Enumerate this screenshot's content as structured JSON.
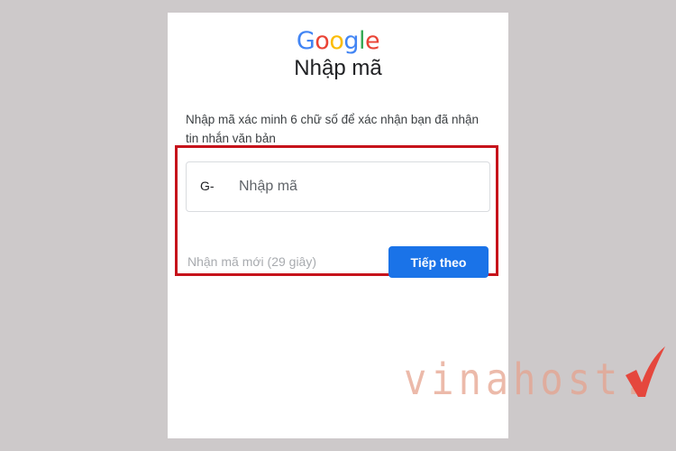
{
  "logo": {
    "letters": [
      "G",
      "o",
      "o",
      "g",
      "l",
      "e"
    ],
    "colors": [
      "#4285f4",
      "#ea4335",
      "#fbbc05",
      "#4285f4",
      "#34a853",
      "#ea4335"
    ]
  },
  "title": "Nhập mã",
  "description": "Nhập mã xác minh 6 chữ số để xác nhận bạn đã nhận tin nhắn văn bản",
  "code_field": {
    "prefix": "G-",
    "placeholder": "Nhập mã",
    "value": ""
  },
  "resend_text": "Nhận mã mới (29 giây)",
  "next_button": "Tiếp theo",
  "watermark": {
    "text": "vinahost.",
    "accent_color": "#e8392e"
  },
  "colors": {
    "primary": "#1a73e8",
    "highlight_border": "#c6131b"
  }
}
